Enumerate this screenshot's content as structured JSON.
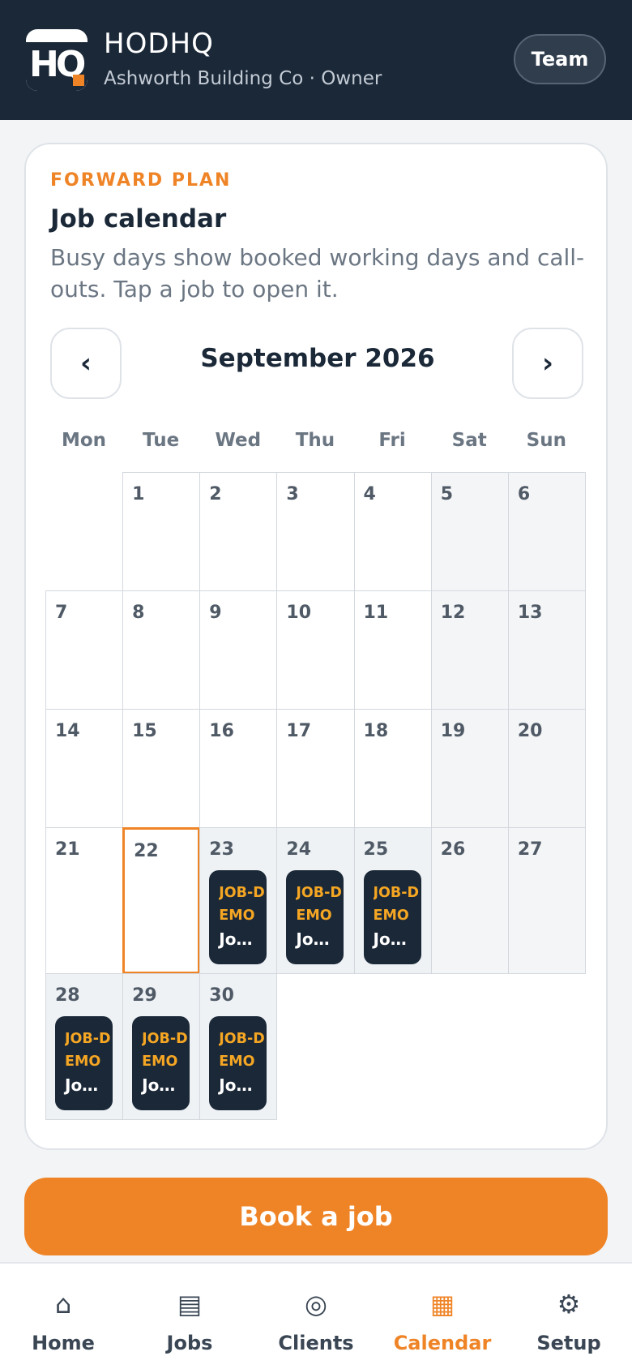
{
  "header": {
    "app_name": "HODHQ",
    "logo_text": "HQ",
    "subtitle": "Ashworth Building Co · Owner",
    "team_button": "Team"
  },
  "calendar_card": {
    "eyebrow": "FORWARD PLAN",
    "title": "Job calendar",
    "description": "Busy days show booked working days and call-outs. Tap a job to open it.",
    "prev_label": "‹",
    "next_label": "›",
    "month_label": "September 2026",
    "weekdays": [
      "Mon",
      "Tue",
      "Wed",
      "Thu",
      "Fri",
      "Sat",
      "Sun"
    ],
    "today": "22",
    "days": [
      {
        "num": "1"
      },
      {
        "num": "2"
      },
      {
        "num": "3"
      },
      {
        "num": "4"
      },
      {
        "num": "5"
      },
      {
        "num": "6"
      },
      {
        "num": "7"
      },
      {
        "num": "8"
      },
      {
        "num": "9"
      },
      {
        "num": "10"
      },
      {
        "num": "11"
      },
      {
        "num": "12"
      },
      {
        "num": "13"
      },
      {
        "num": "14"
      },
      {
        "num": "15"
      },
      {
        "num": "16"
      },
      {
        "num": "17"
      },
      {
        "num": "18"
      },
      {
        "num": "19"
      },
      {
        "num": "20"
      },
      {
        "num": "21"
      },
      {
        "num": "22"
      },
      {
        "num": "23",
        "job": {
          "code": "JOB-DEMO",
          "name": "Jo…"
        }
      },
      {
        "num": "24",
        "job": {
          "code": "JOB-DEMO",
          "name": "Jo…"
        }
      },
      {
        "num": "25",
        "job": {
          "code": "JOB-DEMO",
          "name": "Jo…"
        }
      },
      {
        "num": "26"
      },
      {
        "num": "27"
      },
      {
        "num": "28",
        "job": {
          "code": "JOB-DEMO",
          "name": "Jo…"
        }
      },
      {
        "num": "29",
        "job": {
          "code": "JOB-DEMO",
          "name": "Jo…"
        }
      },
      {
        "num": "30",
        "job": {
          "code": "JOB-DEMO",
          "name": "Jo…"
        }
      }
    ]
  },
  "book_button": "Book a job",
  "bottom_nav": {
    "items": [
      {
        "label": "Home",
        "icon": "⌂",
        "icon_name": "home-icon",
        "active": false
      },
      {
        "label": "Jobs",
        "icon": "▤",
        "icon_name": "jobs-icon",
        "active": false
      },
      {
        "label": "Clients",
        "icon": "◎",
        "icon_name": "clients-icon",
        "active": false
      },
      {
        "label": "Calendar",
        "icon": "▦",
        "icon_name": "calendar-icon",
        "active": true
      },
      {
        "label": "Setup",
        "icon": "⚙",
        "icon_name": "gear-icon",
        "active": false
      }
    ]
  },
  "colors": {
    "header_bg": "#1b2838",
    "accent": "#ef8427",
    "job_code": "#f5a623"
  }
}
